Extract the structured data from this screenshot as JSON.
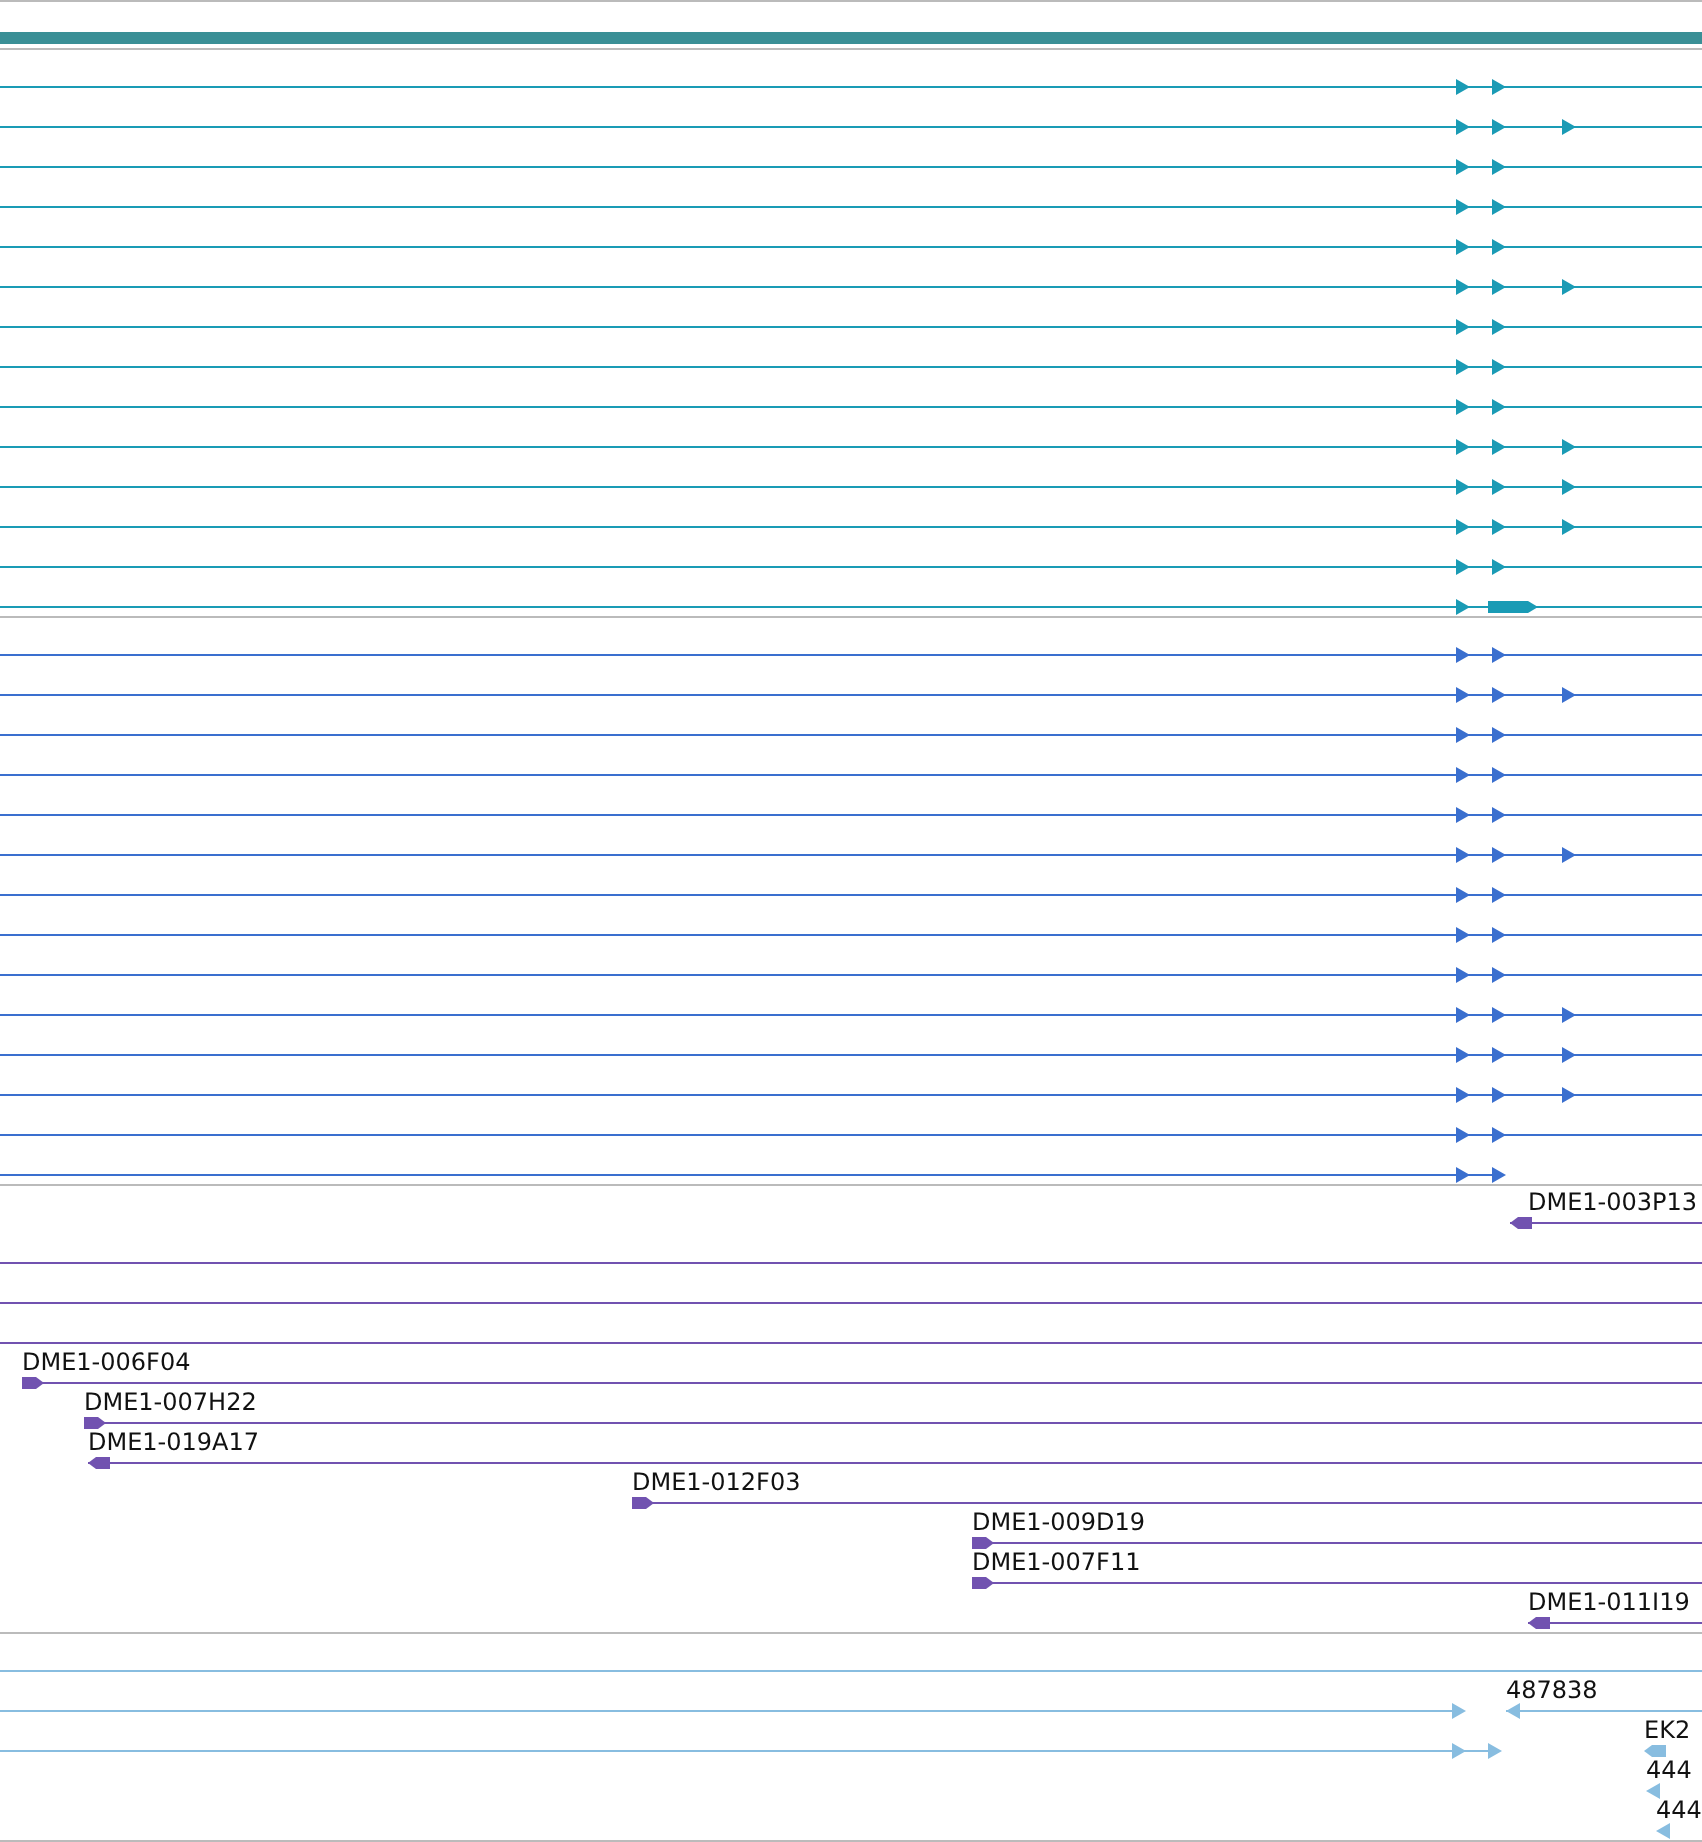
{
  "tracks": [
    {
      "kind": "transcripts",
      "color": "#1a9bb5",
      "rows": [
        {
          "kind": "two"
        },
        {
          "kind": "three"
        },
        {
          "kind": "two"
        },
        {
          "kind": "two"
        },
        {
          "kind": "two"
        },
        {
          "kind": "three"
        },
        {
          "kind": "two"
        },
        {
          "kind": "two"
        },
        {
          "kind": "two"
        },
        {
          "kind": "three"
        },
        {
          "kind": "three"
        },
        {
          "kind": "three"
        },
        {
          "kind": "two"
        },
        {
          "kind": "long"
        }
      ]
    },
    {
      "kind": "transcripts",
      "color": "#3a6fcf",
      "rows": [
        {
          "kind": "two"
        },
        {
          "kind": "three"
        },
        {
          "kind": "two"
        },
        {
          "kind": "two"
        },
        {
          "kind": "two"
        },
        {
          "kind": "three"
        },
        {
          "kind": "two"
        },
        {
          "kind": "two"
        },
        {
          "kind": "two"
        },
        {
          "kind": "three"
        },
        {
          "kind": "three"
        },
        {
          "kind": "three"
        },
        {
          "kind": "two"
        },
        {
          "kind": "short"
        }
      ]
    },
    {
      "kind": "clones",
      "color": "#7152b0",
      "rows": [
        {
          "label": "DME1-003P13",
          "kind": "reverse"
        },
        {
          "kind": "line"
        },
        {
          "kind": "line"
        },
        {
          "kind": "line"
        },
        {
          "label": "DME1-006F04",
          "kind": "forward"
        },
        {
          "label": "DME1-007H22",
          "kind": "forward"
        },
        {
          "label": "DME1-019A17",
          "kind": "reverse"
        },
        {
          "label": "DME1-012F03",
          "kind": "forward"
        },
        {
          "label": "DME1-009D19",
          "kind": "forward"
        },
        {
          "label": "DME1-007F11",
          "kind": "forward"
        },
        {
          "label": "DME1-011I19",
          "kind": "reverse"
        }
      ]
    },
    {
      "kind": "ests",
      "color": "#88bde0",
      "rows": [
        {
          "kind": "line"
        },
        {
          "kind": "split",
          "label": "487838"
        },
        {
          "kind": "pair",
          "label": "EK2"
        },
        {
          "kind": "single",
          "label": "444"
        },
        {
          "kind": "single",
          "label": "444"
        }
      ]
    }
  ]
}
